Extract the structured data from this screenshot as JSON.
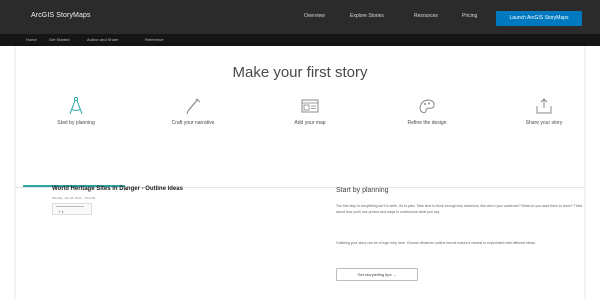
{
  "header": {
    "brand": "ArcGIS StoryMaps",
    "nav": [
      "Overview",
      "Explore Stories",
      "Resources",
      "Pricing"
    ],
    "launch_label": "Launch ArcGIS StoryMaps"
  },
  "subnav": [
    "Home",
    "Get Started",
    "Author and Share",
    "Reference"
  ],
  "main": {
    "title": "Make your first story",
    "steps": [
      {
        "label": "Start by planning",
        "icon": "compass-icon",
        "active": true
      },
      {
        "label": "Craft your narrative",
        "icon": "pen-icon",
        "active": false
      },
      {
        "label": "Add your map",
        "icon": "map-icon",
        "active": false
      },
      {
        "label": "Refine the design",
        "icon": "palette-icon",
        "active": false
      },
      {
        "label": "Share your story",
        "icon": "share-icon",
        "active": false
      }
    ],
    "story": {
      "title": "World Heritage Sites in Danger - Outline ideas",
      "meta": "Monday, Jan 18, 2021 · 4:01 PM",
      "widget_label": "+ 1"
    },
    "panel": {
      "title": "Start by planning",
      "p1": "The first step in storytelling isn't to write, it's to plan. Take time to think through key decisions, like who's your audience? What do you want them to learn? Think about how you'll use photos and maps to underscore what you say.",
      "p2": "Outlining your story can be a huge help here. Choose whatever outline format makes it easiest to experiment with different ideas.",
      "button_label": "Get storytelling tips →"
    }
  },
  "colors": {
    "accent": "#2aa7a4",
    "launch": "#0079c1",
    "topbar": "#2b2b2b"
  }
}
